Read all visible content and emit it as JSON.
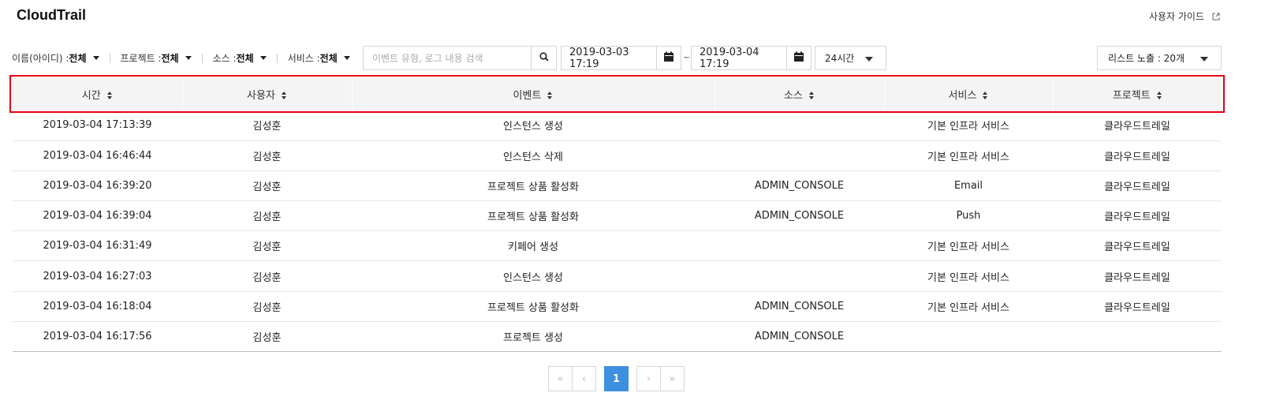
{
  "header": {
    "title": "CloudTrail",
    "guide_label": "사용자 가이드",
    "guide_icon": "external-link-icon"
  },
  "filters": [
    {
      "label": "이름(아이디) :",
      "value": "전체"
    },
    {
      "label": "프로젝트 :",
      "value": "전체"
    },
    {
      "label": "소스 :",
      "value": "전체"
    },
    {
      "label": "서비스 :",
      "value": "전체"
    }
  ],
  "search": {
    "placeholder": "이벤트 유형, 로그 내용 검색",
    "value": "",
    "icon": "search-icon"
  },
  "date_range": {
    "start": "2019-03-03 17:19",
    "separator": "~",
    "end": "2019-03-04 17:19",
    "icon": "calendar-icon",
    "preset": "24시간"
  },
  "list_size": "리스트 노출 : 20개",
  "table": {
    "columns": [
      "시간",
      "사용자",
      "이벤트",
      "소스",
      "서비스",
      "프로젝트"
    ],
    "rows": [
      [
        "2019-03-04 17:13:39",
        "김성훈",
        "인스턴스 생성",
        "",
        "기본 인프라 서비스",
        "클라우드트레일"
      ],
      [
        "2019-03-04 16:46:44",
        "김성훈",
        "인스턴스 삭제",
        "",
        "기본 인프라 서비스",
        "클라우드트레일"
      ],
      [
        "2019-03-04 16:39:20",
        "김성훈",
        "프로젝트 상품 활성화",
        "ADMIN_CONSOLE",
        "Email",
        "클라우드트레일"
      ],
      [
        "2019-03-04 16:39:04",
        "김성훈",
        "프로젝트 상품 활성화",
        "ADMIN_CONSOLE",
        "Push",
        "클라우드트레일"
      ],
      [
        "2019-03-04 16:31:49",
        "김성훈",
        "키페어 생성",
        "",
        "기본 인프라 서비스",
        "클라우드트레일"
      ],
      [
        "2019-03-04 16:27:03",
        "김성훈",
        "인스턴스 생성",
        "",
        "기본 인프라 서비스",
        "클라우드트레일"
      ],
      [
        "2019-03-04 16:18:04",
        "김성훈",
        "프로젝트 상품 활성화",
        "ADMIN_CONSOLE",
        "기본 인프라 서비스",
        "클라우드트레일"
      ],
      [
        "2019-03-04 16:17:56",
        "김성훈",
        "프로젝트 생성",
        "ADMIN_CONSOLE",
        "",
        ""
      ]
    ]
  },
  "pagination": {
    "first": "«",
    "prev": "‹",
    "current": "1",
    "next": "›",
    "last": "»"
  },
  "colors": {
    "highlight": "#e60012",
    "active_page": "#3d8fe0",
    "header_bg": "#f4f4f4"
  }
}
